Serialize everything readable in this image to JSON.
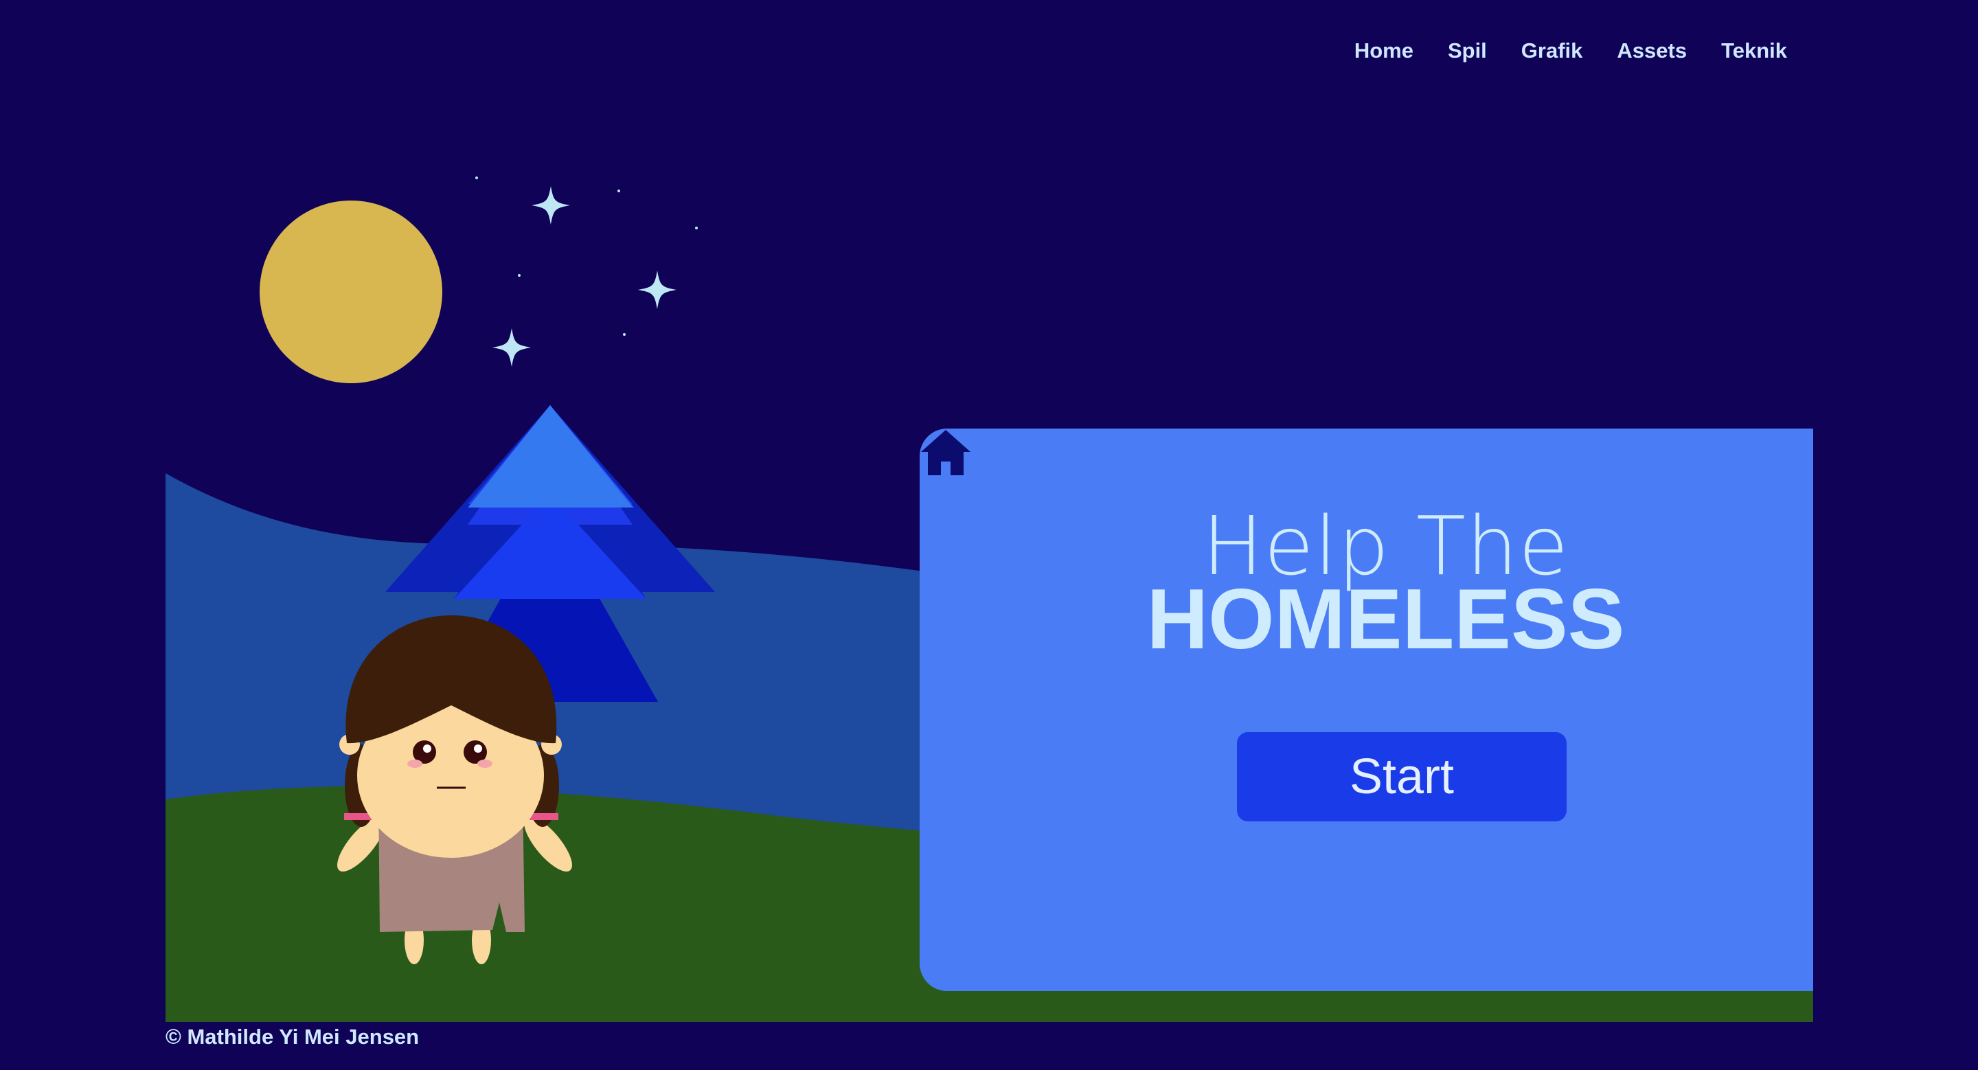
{
  "nav": {
    "items": [
      {
        "label": "Home"
      },
      {
        "label": "Spil"
      },
      {
        "label": "Grafik"
      },
      {
        "label": "Assets"
      },
      {
        "label": "Teknik"
      }
    ]
  },
  "game": {
    "title_line1": "Help The",
    "title_line2": "HOMELESS",
    "start_label": "Start",
    "home_icon": "house-icon"
  },
  "footer": {
    "copyright": "© Mathilde Yi Mei Jensen"
  },
  "colors": {
    "background": "#0f0257",
    "panel": "#4a7cf5",
    "button": "#1a3be8",
    "text": "#cfecff",
    "moon": "#d8b650",
    "grass": "#2a5a1a",
    "hills": "#1e4aa0"
  }
}
